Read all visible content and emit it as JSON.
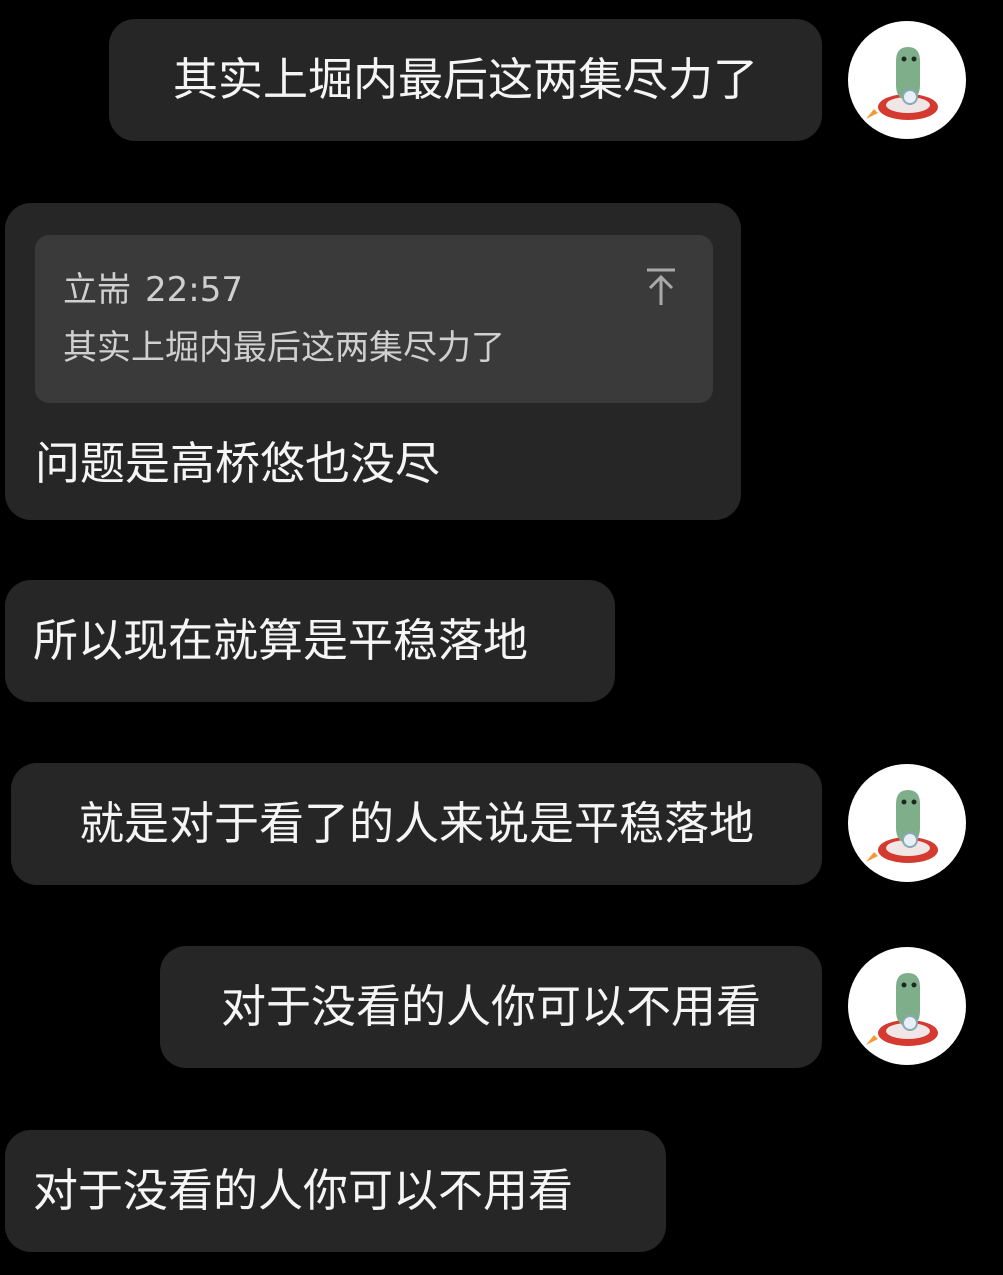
{
  "messages": [
    {
      "text": "其实上堀内最后这两集尽力了"
    },
    {
      "text": "问题是高桥悠也没尽",
      "quote": {
        "sender": "立耑",
        "time": "22:57",
        "text": "其实上堀内最后这两集尽力了"
      }
    },
    {
      "text": "所以现在就算是平稳落地"
    },
    {
      "text": "就是对于看了的人来说是平稳落地"
    },
    {
      "text": "对于没看的人你可以不用看"
    },
    {
      "text": "对于没看的人你可以不用看"
    }
  ],
  "avatar": {
    "icon": "green-dinosaur-on-rocket-icon"
  },
  "colors": {
    "background": "#000000",
    "bubble": "#262626",
    "quote": "#3a3a3a",
    "text": "#f5f5f5",
    "quote_text": "#d0d0d0",
    "dino": "#7fae8a",
    "rocket": "#d43a2f"
  }
}
